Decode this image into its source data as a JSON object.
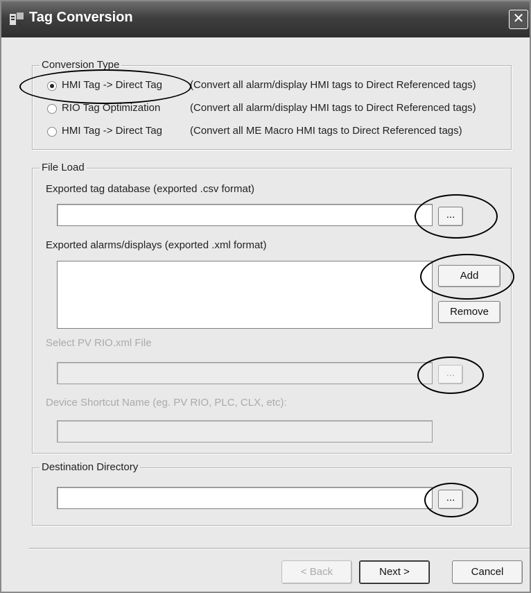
{
  "window": {
    "title": "Tag Conversion",
    "close_glyph": "✕"
  },
  "conversion_type": {
    "legend": "Conversion Type",
    "options": [
      {
        "label": "HMI Tag -> Direct Tag",
        "desc": "(Convert all alarm/display HMI tags to Direct Referenced tags)",
        "selected": true
      },
      {
        "label": "RIO Tag Optimization",
        "desc": "(Convert all alarm/display HMI tags to Direct Referenced tags)",
        "selected": false
      },
      {
        "label": "HMI Tag -> Direct Tag",
        "desc": "(Convert all ME Macro HMI tags to Direct Referenced tags)",
        "selected": false
      }
    ]
  },
  "file_load": {
    "legend": "File Load",
    "tag_db_label": "Exported tag database (exported .csv format)",
    "tag_db_value": "",
    "browse_label": "...",
    "alarms_label": "Exported alarms/displays (exported .xml format)",
    "add_label": "Add",
    "remove_label": "Remove",
    "pv_rio_label": "Select PV RIO.xml File",
    "pv_rio_value": "",
    "shortcut_label": "Device Shortcut Name (eg. PV RIO, PLC, CLX, etc):",
    "shortcut_value": ""
  },
  "destination": {
    "legend": "Destination Directory",
    "value": "",
    "browse_label": "..."
  },
  "footer": {
    "back_label": "< Back",
    "next_label": "Next >",
    "cancel_label": "Cancel"
  },
  "colors": {
    "titlebar": "#3f3f3f",
    "dialog_bg": "#e9e9e9",
    "annotation": "#000000"
  }
}
